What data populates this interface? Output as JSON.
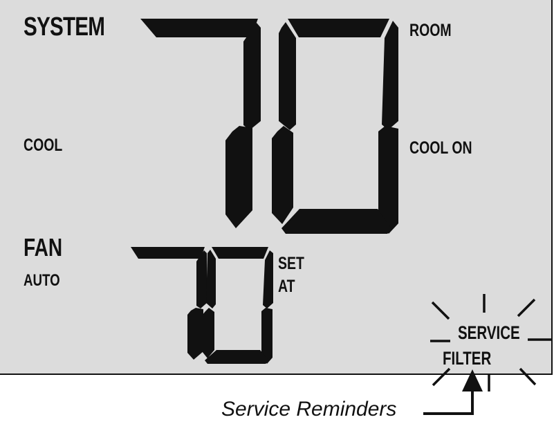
{
  "display": {
    "system_label": "SYSTEM",
    "mode_label": "COOL",
    "fan_label": "FAN",
    "fan_mode": "AUTO",
    "room_label": "ROOM",
    "status_label": "COOL ON",
    "room_temperature": "70",
    "set_label_line1": "SET",
    "set_label_line2": "AT",
    "set_temperature": "70",
    "service_label": "SERVICE",
    "filter_label": "FILTER",
    "service_indicator": "flashing"
  },
  "caption": {
    "text": "Service  Reminders"
  }
}
